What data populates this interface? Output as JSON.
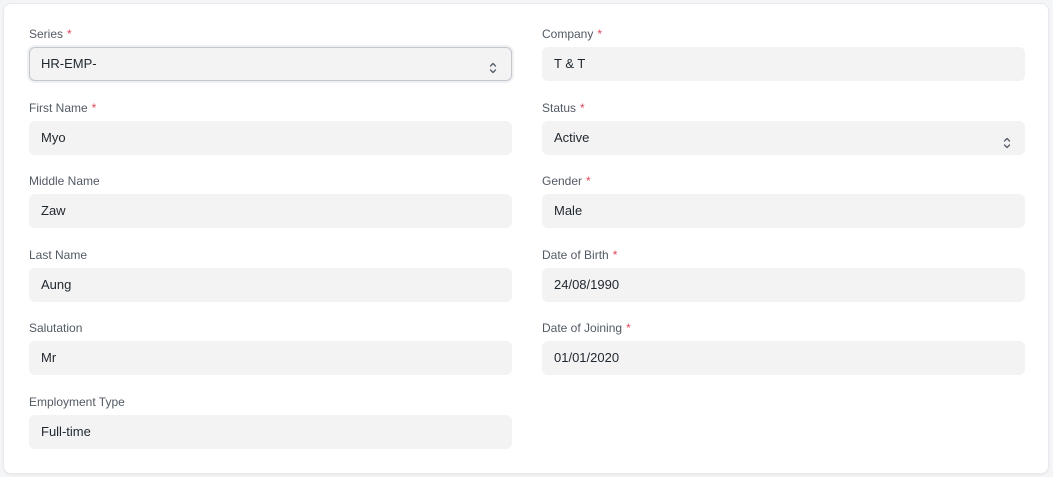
{
  "form": {
    "left": [
      {
        "key": "series",
        "label": "Series",
        "required": true,
        "value": "HR-EMP-",
        "type": "select",
        "focused": true
      },
      {
        "key": "first_name",
        "label": "First Name",
        "required": true,
        "value": "Myo",
        "type": "text"
      },
      {
        "key": "middle_name",
        "label": "Middle Name",
        "required": false,
        "value": "Zaw",
        "type": "text"
      },
      {
        "key": "last_name",
        "label": "Last Name",
        "required": false,
        "value": "Aung",
        "type": "text"
      },
      {
        "key": "salutation",
        "label": "Salutation",
        "required": false,
        "value": "Mr",
        "type": "text"
      },
      {
        "key": "employment_type",
        "label": "Employment Type",
        "required": false,
        "value": "Full-time",
        "type": "text"
      }
    ],
    "right": [
      {
        "key": "company",
        "label": "Company",
        "required": true,
        "value": "T & T",
        "type": "text"
      },
      {
        "key": "status",
        "label": "Status",
        "required": true,
        "value": "Active",
        "type": "select"
      },
      {
        "key": "gender",
        "label": "Gender",
        "required": true,
        "value": "Male",
        "type": "text"
      },
      {
        "key": "date_of_birth",
        "label": "Date of Birth",
        "required": true,
        "value": "24/08/1990",
        "type": "text"
      },
      {
        "key": "date_of_joining",
        "label": "Date of Joining",
        "required": true,
        "value": "01/01/2020",
        "type": "text"
      }
    ]
  },
  "icons": {
    "select_indicator": "chevron-up-down-icon"
  },
  "colors": {
    "required_marker": "#e2475a",
    "field_background": "#f3f3f4",
    "label_text": "#525a64",
    "value_text": "#1f272e"
  },
  "required_marker": "*"
}
